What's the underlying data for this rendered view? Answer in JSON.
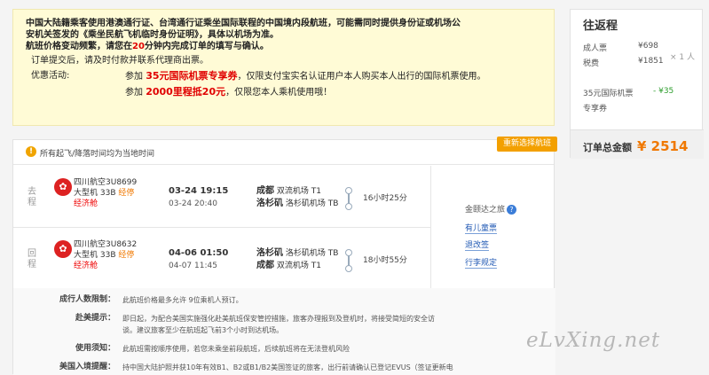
{
  "notice": {
    "line1": "中国大陆籍乘客使用港澳通行证、台湾通行证乘坐国际联程的中国境内段航班，可能需同时提供身份证或机场公",
    "line2": "安机关签发的《乘坐民航飞机临时身份证明》，具体以机场为准。",
    "line3_pre": "航班价格变动频繁，请您在",
    "line3_min": "20",
    "line3_post": "分钟内完成订单的填写与确认。",
    "line4": "订单提交后，请及时付款并联系代理商出票。",
    "promo_label": "优惠活动:",
    "promo1_pre": "参加",
    "promo1_amt": "35元国际机票专享券",
    "promo1_post": "，仅限支付宝实名认证用户本人购买本人出行的国际机票使用。",
    "promo2_pre": "参加",
    "promo2_amt": "2000里程抵20元",
    "promo2_post": "，仅限您本人乘机使用哦！"
  },
  "summary": {
    "title": "往返程",
    "adult_label": "成人票",
    "adult_price": "¥698",
    "tax_label": "税费",
    "tax_price": "¥1851",
    "qty": "× 1 人",
    "coupon_label": "35元国际机票",
    "coupon_value": "- ¥35",
    "coupon_sub": "专享券",
    "total_label": "订单总金额",
    "total_price": "¥ 2514"
  },
  "flights": {
    "header": "所有起飞/降落时间均为当地时间",
    "rebook": "重新选择航班",
    "segments": [
      {
        "label": "去程",
        "airline": "四川航空3U8699",
        "aircraft": "大型机 33B",
        "rec": "经停",
        "cabin": "经济舱",
        "dep_time": "03-24 19:15",
        "arr_time": "03-24 20:40",
        "dep_city": "成都",
        "dep_airport": "双流机场 T1",
        "arr_city": "洛杉矶",
        "arr_airport": "洛杉矶机场 TB",
        "duration": "16小时25分"
      },
      {
        "label": "回程",
        "airline": "四川航空3U8632",
        "aircraft": "大型机 33B",
        "rec": "经停",
        "cabin": "经济舱",
        "dep_time": "04-06 01:50",
        "arr_time": "04-07 11:45",
        "dep_city": "洛杉矶",
        "dep_airport": "洛杉矶机场 TB",
        "arr_city": "成都",
        "arr_airport": "双流机场 T1",
        "duration": "18小时55分"
      }
    ],
    "brand": "金颐达之旅",
    "brand_q": "?",
    "links": [
      "有儿童票",
      "退改签",
      "行李规定"
    ]
  },
  "rules": [
    {
      "k": "成行人数限制：",
      "v": "此航班价格最多允许 9位乘机人预订。"
    },
    {
      "k": "赴美提示：",
      "v": "即日起，为配合美国实施强化赴美航班保安管控措施，旅客办理报到及登机时，将接受简短的安全访"
    },
    {
      "k": "",
      "v": "谈。建议旅客至少在航班起飞前3个小时到达机场。"
    },
    {
      "k": "使用须知：",
      "v": "此航班需按顺序使用，若您未乘坐前段航班，后续航班将在无法登机风险"
    },
    {
      "k": "美国入境提醒：",
      "v": "持中国大陆护照并获10年有效B1、B2或B1/B2美国签证的旅客，出行前请确认已登记EVUS（签证更新电"
    }
  ],
  "watermark": "eLvXing.net"
}
